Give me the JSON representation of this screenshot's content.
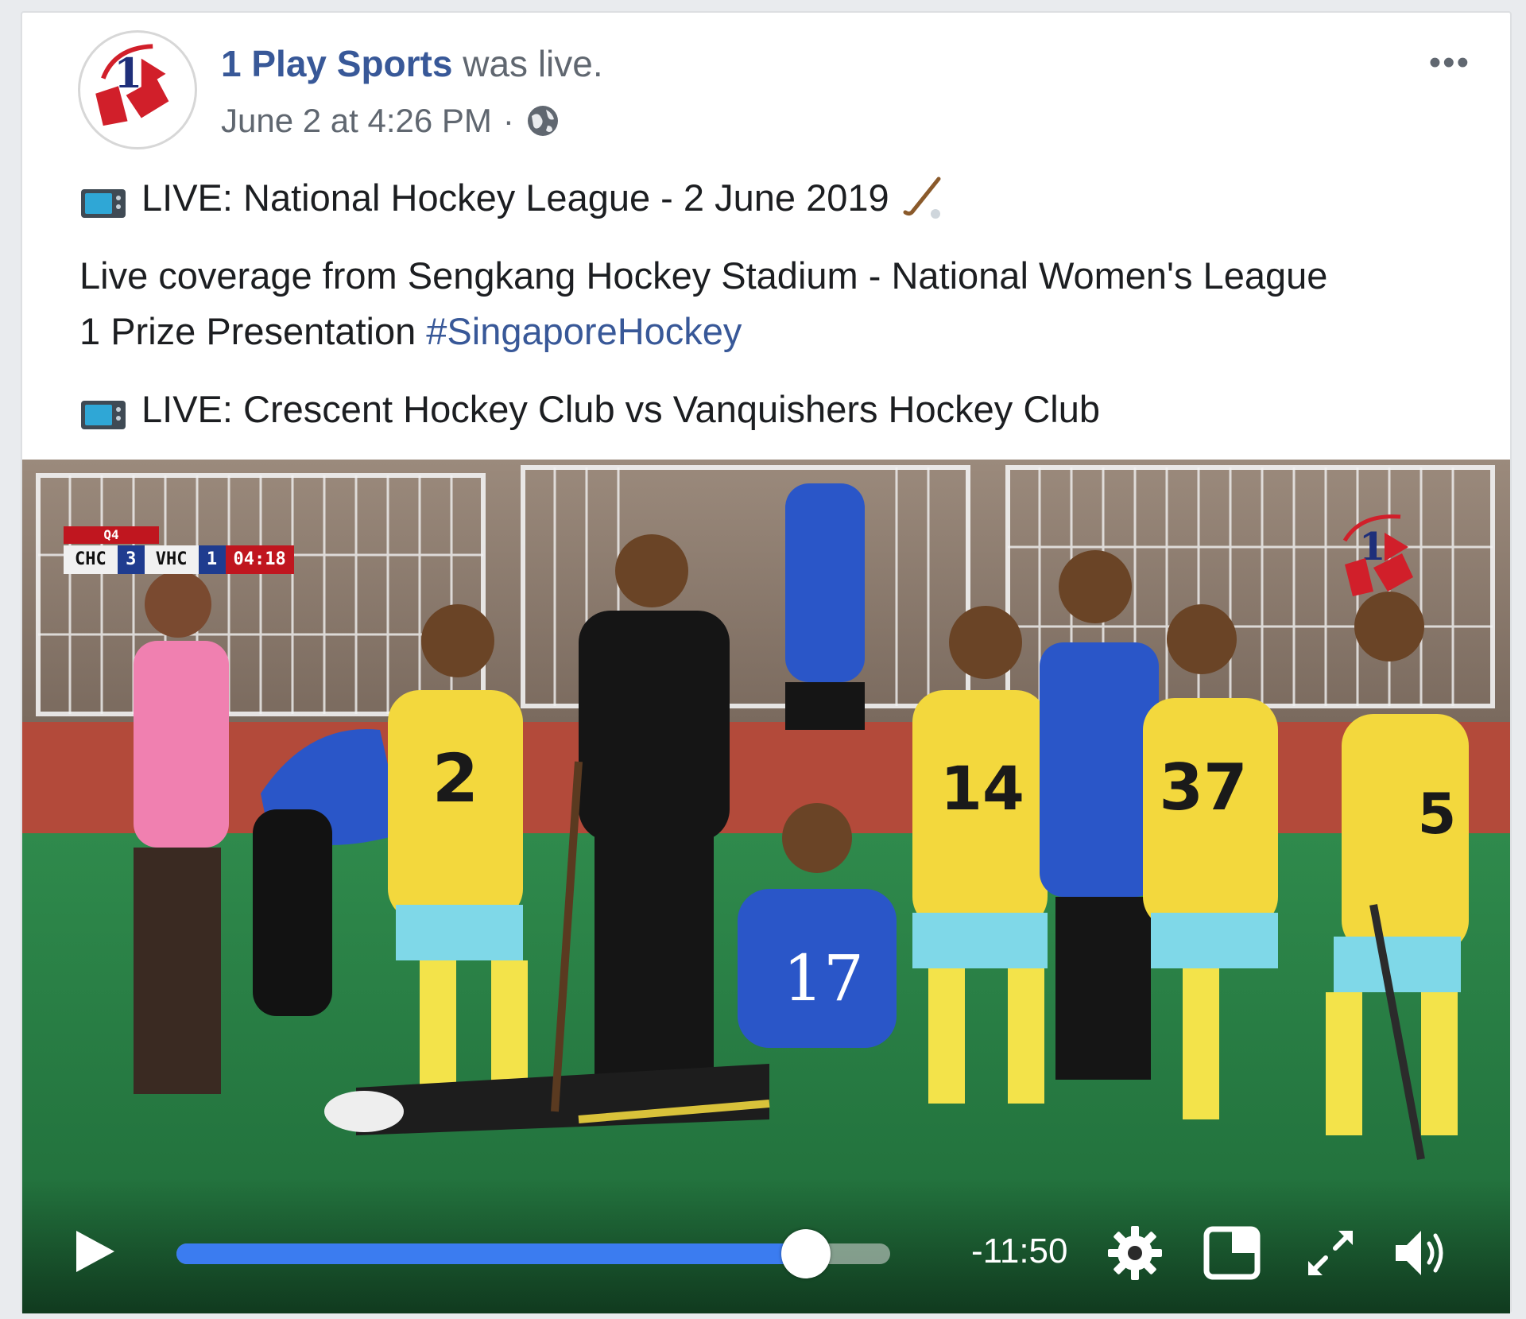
{
  "post": {
    "author": "1 Play Sports",
    "action": "was live.",
    "timestamp": "June 2 at 4:26 PM",
    "separator": "·",
    "audience_icon": "globe-icon",
    "more_label": "•••",
    "text_line_1": "LIVE: National Hockey League - 2 June 2019",
    "text_line_2": "Live coverage from Sengkang Hockey Stadium - National Women's League",
    "text_line_3_prefix": "1 Prize Presentation ",
    "hashtag": "#SingaporeHockey",
    "text_line_4": "LIVE: Crescent Hockey Club vs Vanquishers Hockey Club"
  },
  "video": {
    "scoreboard": {
      "period": "Q4",
      "team_home": "CHC",
      "score_home": "3",
      "team_away": "VHC",
      "score_away": "1",
      "clock": "04:18"
    },
    "controls": {
      "time_remaining": "-11:50",
      "progress_fraction": 0.882
    }
  },
  "colors": {
    "link": "#385898",
    "progress": "#3b7cf0",
    "secondary_text": "#606770"
  }
}
